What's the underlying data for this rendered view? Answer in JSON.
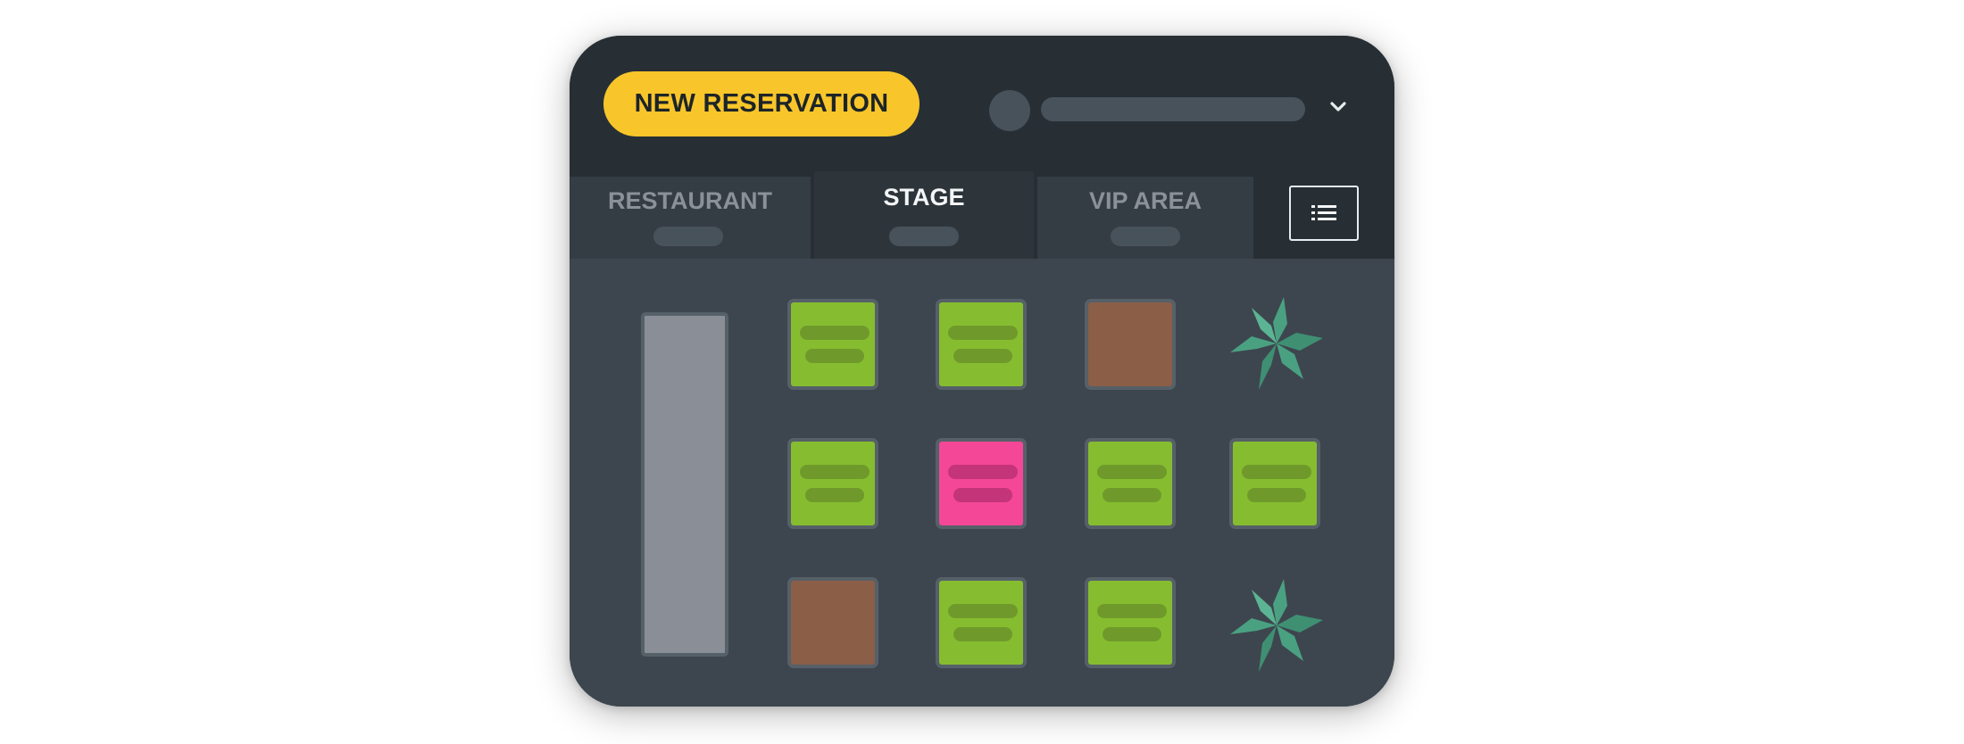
{
  "header": {
    "new_reservation_label": "NEW RESERVATION"
  },
  "tabs": [
    {
      "label": "RESTAURANT",
      "active": false
    },
    {
      "label": "STAGE",
      "active": true
    },
    {
      "label": "VIP AREA",
      "active": false
    }
  ],
  "icons": {
    "chevron": "chevron-down-icon",
    "list": "list-icon",
    "plant": "plant-icon",
    "avatar": "avatar"
  },
  "floor": {
    "tables": [
      {
        "status": "free"
      },
      {
        "status": "free"
      },
      {
        "status": "blocked"
      },
      {
        "status": "free"
      },
      {
        "status": "reserved"
      },
      {
        "status": "free"
      },
      {
        "status": "free"
      },
      {
        "status": "blocked"
      },
      {
        "status": "free"
      },
      {
        "status": "free"
      }
    ]
  },
  "colors": {
    "accent": "#f8c62a",
    "free": "#86bd30",
    "reserved": "#f44797",
    "blocked": "#8b5e48",
    "header_bg": "#272f35",
    "floor_bg": "#3d464e",
    "plant": "#4aa182"
  }
}
